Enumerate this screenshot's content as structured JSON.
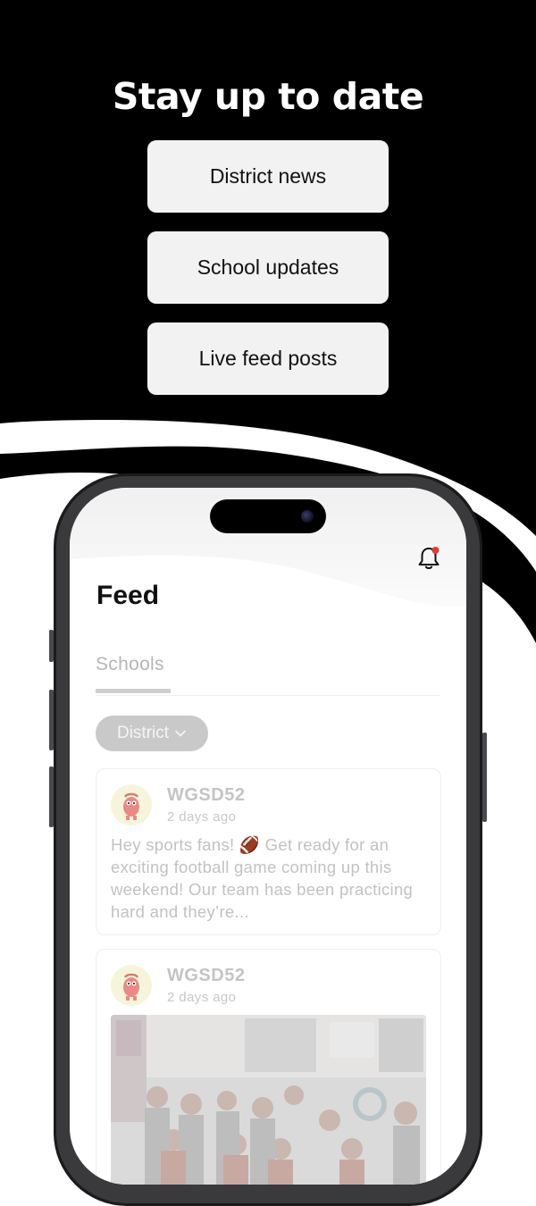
{
  "promo": {
    "headline": "Stay up to date",
    "features": [
      "District news",
      "School updates",
      "Live feed posts"
    ]
  },
  "app": {
    "screen_title": "Feed",
    "tabs": [
      {
        "label": "Schools",
        "active": true
      }
    ],
    "filter": {
      "label": "District",
      "icon": "chevron-down-icon"
    },
    "notification_icon": "bell-icon",
    "posts": [
      {
        "author": "WGSD52",
        "time": "2 days ago",
        "text": "Hey sports fans! 🏈 Get ready for an exciting football game coming up this weekend! Our team has been practicing hard and they’re..."
      },
      {
        "author": "WGSD52",
        "time": "2 days ago",
        "image": "classroom-group-photo"
      }
    ]
  },
  "colors": {
    "background_dark": "#000000",
    "card_bg": "#f2f2f2",
    "badge_red": "#e53935",
    "muted_text": "#c2c2c2"
  }
}
